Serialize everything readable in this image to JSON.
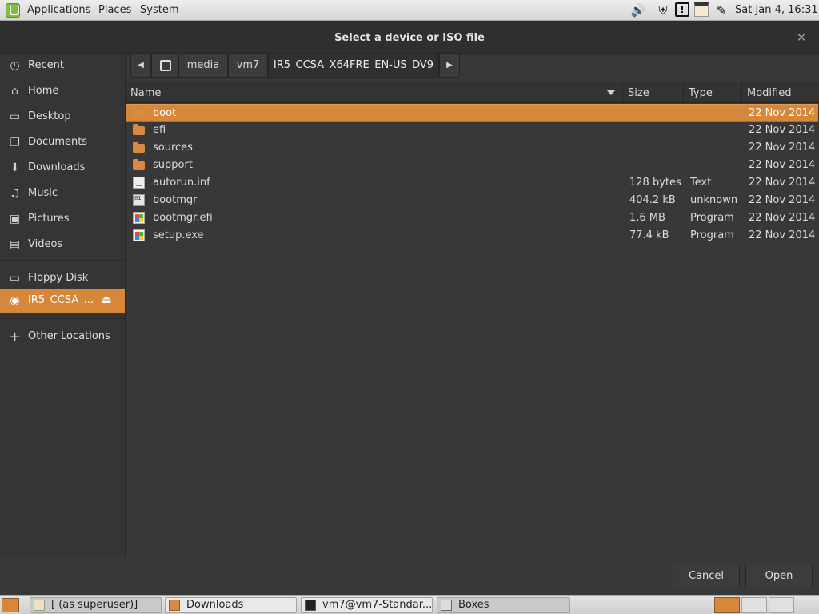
{
  "top_panel": {
    "menus": [
      "Applications",
      "Places",
      "System"
    ],
    "clock": "Sat Jan  4, 16:31",
    "tray_icons": [
      "volume-icon",
      "shield-icon",
      "clipboard-icon",
      "calendar-icon",
      "network-icon"
    ]
  },
  "dialog": {
    "title": "Select a device or ISO file",
    "close_glyph": "✕"
  },
  "sidebar": {
    "items": [
      {
        "label": "Recent",
        "icon": "clock-icon",
        "glyph": "◷"
      },
      {
        "label": "Home",
        "icon": "home-icon",
        "glyph": "⌂"
      },
      {
        "label": "Desktop",
        "icon": "desktop-icon",
        "glyph": "▭"
      },
      {
        "label": "Documents",
        "icon": "documents-icon",
        "glyph": "❐"
      },
      {
        "label": "Downloads",
        "icon": "downloads-icon",
        "glyph": "⬇"
      },
      {
        "label": "Music",
        "icon": "music-icon",
        "glyph": "♫"
      },
      {
        "label": "Pictures",
        "icon": "pictures-icon",
        "glyph": "▣"
      },
      {
        "label": "Videos",
        "icon": "videos-icon",
        "glyph": "▤"
      }
    ],
    "devices": [
      {
        "label": "Floppy Disk",
        "icon": "floppy-icon",
        "glyph": "▭"
      },
      {
        "label": "IR5_CCSA_...",
        "icon": "disc-icon",
        "glyph": "◉"
      }
    ],
    "other": {
      "label": "Other Locations",
      "glyph": "+"
    }
  },
  "pathbar": {
    "back_glyph": "◀",
    "crumbs": [
      "media",
      "vm7",
      "IR5_CCSA_X64FRE_EN-US_DV9"
    ],
    "forward_glyph": "▶"
  },
  "columns": {
    "name": "Name",
    "size": "Size",
    "type": "Type",
    "modified": "Modified"
  },
  "files": [
    {
      "name": "boot",
      "size": "",
      "type": "",
      "modified": "22 Nov 2014",
      "kind": "folder"
    },
    {
      "name": "efi",
      "size": "",
      "type": "",
      "modified": "22 Nov 2014",
      "kind": "folder"
    },
    {
      "name": "sources",
      "size": "",
      "type": "",
      "modified": "22 Nov 2014",
      "kind": "folder"
    },
    {
      "name": "support",
      "size": "",
      "type": "",
      "modified": "22 Nov 2014",
      "kind": "folder"
    },
    {
      "name": "autorun.inf",
      "size": "128 bytes",
      "type": "Text",
      "modified": "22 Nov 2014",
      "kind": "text"
    },
    {
      "name": "bootmgr",
      "size": "404.2 kB",
      "type": "unknown",
      "modified": "22 Nov 2014",
      "kind": "binary"
    },
    {
      "name": "bootmgr.efi",
      "size": "1.6 MB",
      "type": "Program",
      "modified": "22 Nov 2014",
      "kind": "program"
    },
    {
      "name": "setup.exe",
      "size": "77.4 kB",
      "type": "Program",
      "modified": "22 Nov 2014",
      "kind": "program"
    }
  ],
  "buttons": {
    "cancel": "Cancel",
    "open": "Open"
  },
  "taskbar": {
    "tasks": [
      "[ (as superuser)]",
      "Downloads",
      "vm7@vm7-Standar...",
      "Boxes"
    ]
  },
  "colors": {
    "accent": "#d6873a",
    "background": "#383838"
  }
}
